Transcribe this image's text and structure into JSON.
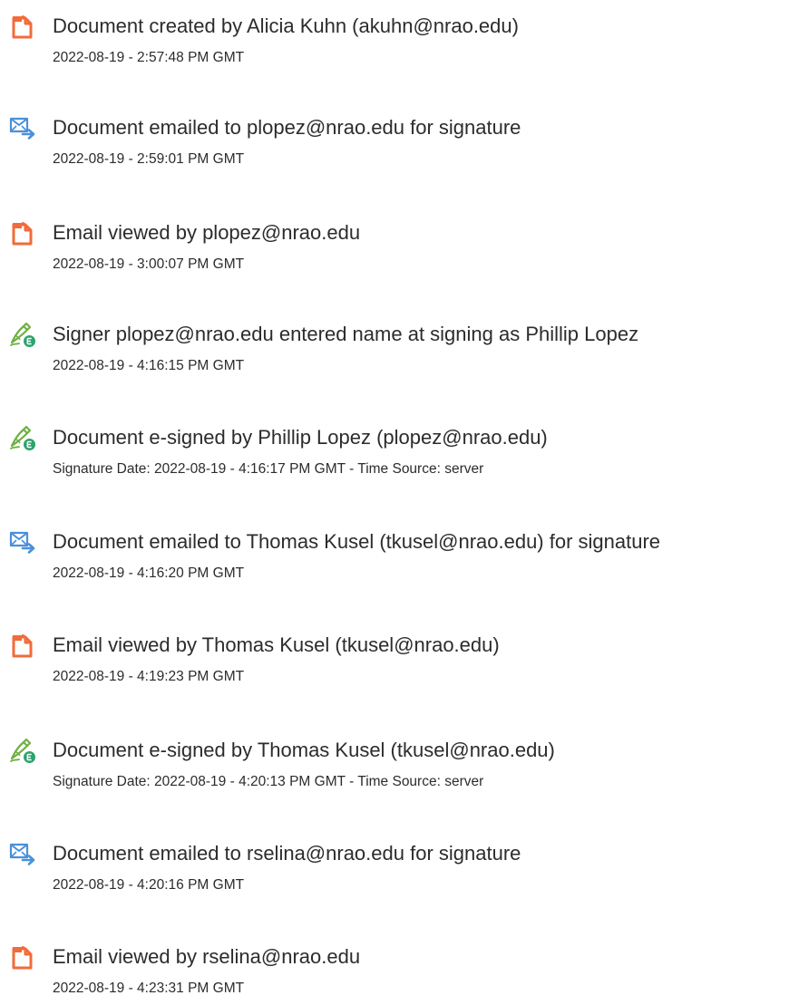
{
  "events": [
    {
      "icon": "document-icon",
      "text": "Document created by Alicia Kuhn (akuhn@nrao.edu)",
      "date": "2022-08-19 - 2:57:48 PM GMT"
    },
    {
      "icon": "email-icon",
      "text": "Document emailed to plopez@nrao.edu for signature",
      "date": "2022-08-19 - 2:59:01 PM GMT"
    },
    {
      "icon": "document-icon",
      "text": "Email viewed by plopez@nrao.edu",
      "date": "2022-08-19 - 3:00:07 PM GMT"
    },
    {
      "icon": "esign-icon",
      "text": "Signer plopez@nrao.edu entered name at signing as Phillip Lopez",
      "date": "2022-08-19 - 4:16:15 PM GMT"
    },
    {
      "icon": "esign-icon",
      "text": "Document e-signed by Phillip Lopez (plopez@nrao.edu)",
      "date": "Signature Date: 2022-08-19 - 4:16:17 PM GMT - Time Source: server"
    },
    {
      "icon": "email-icon",
      "text": "Document emailed to Thomas Kusel (tkusel@nrao.edu) for signature",
      "date": "2022-08-19 - 4:16:20 PM GMT"
    },
    {
      "icon": "document-icon",
      "text": "Email viewed by Thomas Kusel (tkusel@nrao.edu)",
      "date": "2022-08-19 - 4:19:23 PM GMT"
    },
    {
      "icon": "esign-icon",
      "text": "Document e-signed by Thomas Kusel (tkusel@nrao.edu)",
      "date": "Signature Date: 2022-08-19 - 4:20:13 PM GMT - Time Source: server"
    },
    {
      "icon": "email-icon",
      "text": "Document emailed to rselina@nrao.edu for signature",
      "date": "2022-08-19 - 4:20:16 PM GMT"
    },
    {
      "icon": "document-icon",
      "text": "Email viewed by rselina@nrao.edu",
      "date": "2022-08-19 - 4:23:31 PM GMT"
    }
  ],
  "colors": {
    "document_icon": "#f26b3a",
    "email_icon": "#4a90d9",
    "esign_pen": "#6fb043",
    "esign_badge": "#2ea36c"
  }
}
